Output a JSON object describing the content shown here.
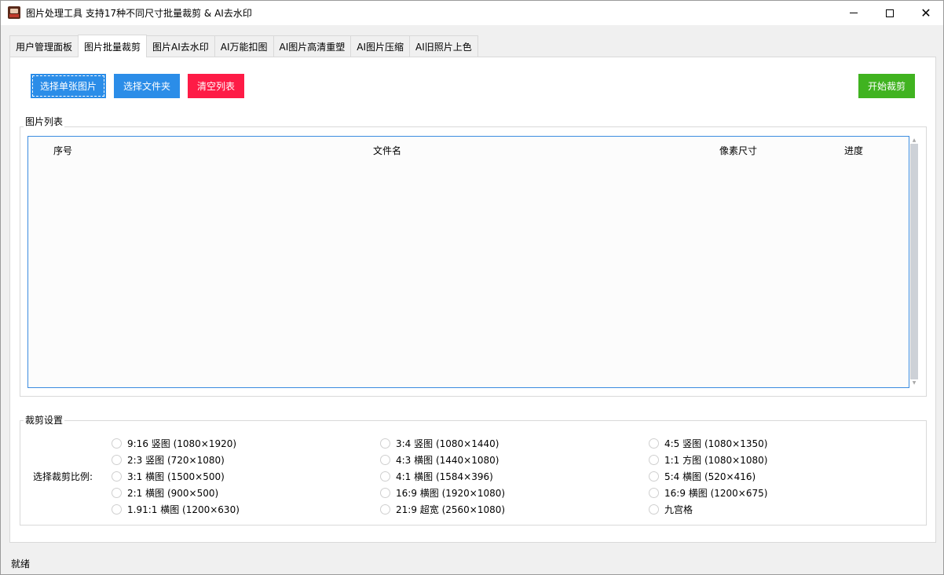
{
  "window": {
    "title": "图片处理工具 支持17种不同尺寸批量裁剪 & AI去水印",
    "icon": "app-icon",
    "controls": {
      "minimize": "minimize-icon",
      "maximize": "maximize-icon",
      "close": "close-icon"
    }
  },
  "tabs": [
    {
      "label": "用户管理面板",
      "active": false
    },
    {
      "label": "图片批量裁剪",
      "active": true
    },
    {
      "label": "图片AI去水印",
      "active": false
    },
    {
      "label": "AI万能扣图",
      "active": false
    },
    {
      "label": "AI图片高清重塑",
      "active": false
    },
    {
      "label": "AI图片压缩",
      "active": false
    },
    {
      "label": "AI旧照片上色",
      "active": false
    }
  ],
  "toolbar": {
    "select_single_label": "选择单张图片",
    "select_folder_label": "选择文件夹",
    "clear_list_label": "清空列表",
    "start_crop_label": "开始裁剪"
  },
  "image_list": {
    "legend": "图片列表",
    "columns": [
      "序号",
      "文件名",
      "像素尺寸",
      "进度"
    ],
    "rows": []
  },
  "crop_settings": {
    "legend": "裁剪设置",
    "ratio_label": "选择裁剪比例:",
    "options": [
      {
        "label": "9:16 竖图 (1080×1920)",
        "checked": false
      },
      {
        "label": "3:4 竖图 (1080×1440)",
        "checked": false
      },
      {
        "label": "4:5 竖图 (1080×1350)",
        "checked": false
      },
      {
        "label": "2:3 竖图 (720×1080)",
        "checked": false
      },
      {
        "label": "4:3 横图 (1440×1080)",
        "checked": false
      },
      {
        "label": "1:1 方图 (1080×1080)",
        "checked": false
      },
      {
        "label": "3:1 横图 (1500×500)",
        "checked": false
      },
      {
        "label": "4:1 横图 (1584×396)",
        "checked": false
      },
      {
        "label": "5:4 横图 (520×416)",
        "checked": false
      },
      {
        "label": "2:1 横图 (900×500)",
        "checked": false
      },
      {
        "label": "16:9 横图 (1920×1080)",
        "checked": false
      },
      {
        "label": "16:9 横图 (1200×675)",
        "checked": false
      },
      {
        "label": "1.91:1 横图 (1200×630)",
        "checked": false
      },
      {
        "label": "21:9 超宽 (2560×1080)",
        "checked": false
      },
      {
        "label": "九宫格",
        "checked": false
      }
    ]
  },
  "status_bar": {
    "text": "就绪"
  },
  "colors": {
    "blue_button": "#2b8de8",
    "red_button": "#fe1b46",
    "green_button": "#40b320",
    "list_border": "#3c8ce0"
  }
}
